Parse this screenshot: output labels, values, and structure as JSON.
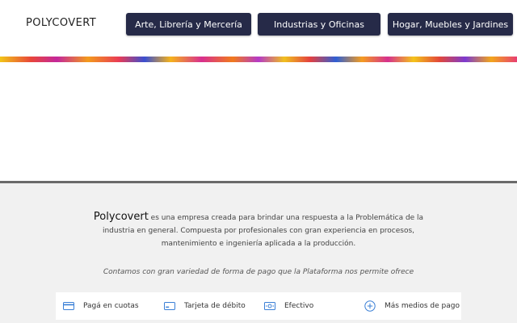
{
  "header": {
    "logo": "POLYCOVERT",
    "nav": [
      {
        "label": "Arte, Librería y Mercería"
      },
      {
        "label": "Industrias y Oficinas"
      },
      {
        "label": "Hogar, Muebles y Jardines"
      }
    ]
  },
  "footer": {
    "brand": "Polycovert",
    "about_text": "es una empresa creada para brindar una respuesta a la Problemática de la industria en general. Compuesta por profesionales con gran experiencia en procesos, mantenimiento e ingeniería aplicada a la producción.",
    "payment_note": "Contamos con gran variedad de forma de pago que la Plataforma nos permite ofrece",
    "payment_methods": [
      {
        "label": "Pagá en cuotas",
        "icon": "credit-card-icon"
      },
      {
        "label": "Tarjeta de débito",
        "icon": "debit-card-icon"
      },
      {
        "label": "Efectivo",
        "icon": "cash-icon"
      },
      {
        "label": "Más medios de pago",
        "icon": "plus-circle-icon"
      }
    ]
  },
  "colors": {
    "nav_button_bg": "#262a48",
    "footer_bg": "#f1f1f1",
    "icon_blue": "#3a7fd6"
  }
}
